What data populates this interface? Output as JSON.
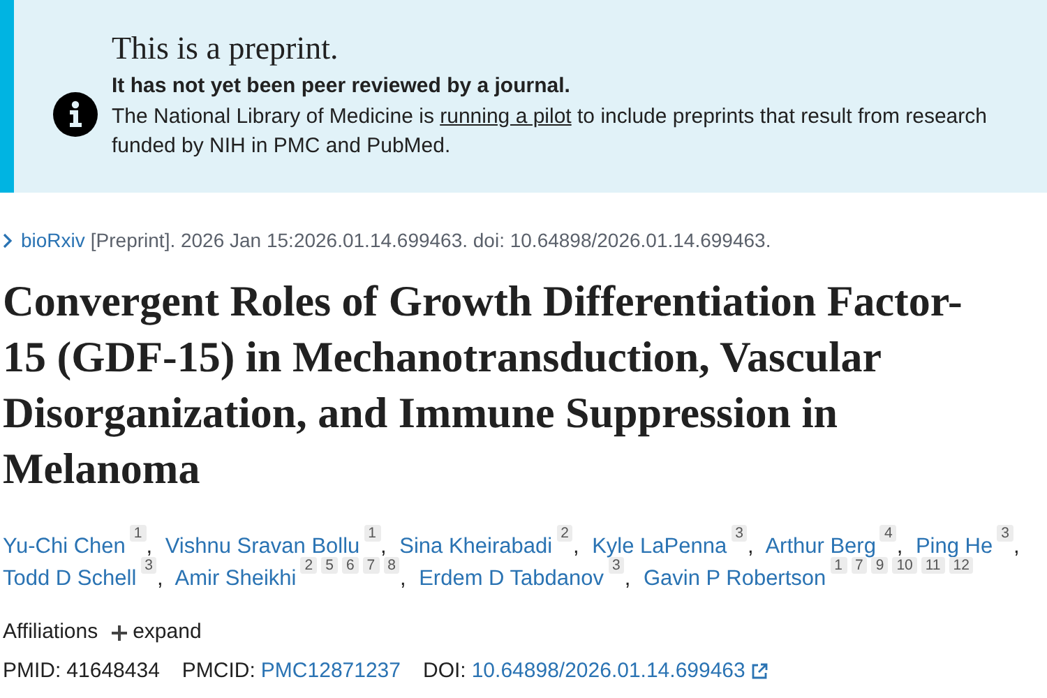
{
  "notice": {
    "title": "This is a preprint.",
    "subtitle": "It has not yet been peer reviewed by a journal.",
    "body_before": "The National Library of Medicine is",
    "link": "running a pilot",
    "body_after": "to include preprints that result from research funded by NIH in PMC and PubMed."
  },
  "citation": {
    "source": "bioRxiv",
    "details": "[Preprint]. 2026 Jan 15:2026.01.14.699463. doi: 10.64898/2026.01.14.699463."
  },
  "title": "Convergent Roles of Growth Differentiation Factor-15 (GDF-15) in Mechanotransduction, Vascular Disorganization, and Immune Suppression in Melanoma",
  "authors": [
    {
      "name": "Yu-Chi Chen",
      "affiliations": [
        "1"
      ],
      "separator": ","
    },
    {
      "name": "Vishnu Sravan Bollu",
      "affiliations": [
        "1"
      ],
      "separator": ","
    },
    {
      "name": "Sina Kheirabadi",
      "affiliations": [
        "2"
      ],
      "separator": ","
    },
    {
      "name": "Kyle LaPenna",
      "affiliations": [
        "3"
      ],
      "separator": ","
    },
    {
      "name": "Arthur Berg",
      "affiliations": [
        "4"
      ],
      "separator": ","
    },
    {
      "name": "Ping He",
      "affiliations": [
        "3"
      ],
      "separator": ","
    },
    {
      "name": "Todd D Schell",
      "affiliations": [
        "3"
      ],
      "separator": ","
    },
    {
      "name": "Amir Sheikhi",
      "affiliations": [
        "2",
        "5",
        "6",
        "7",
        "8"
      ],
      "separator": ","
    },
    {
      "name": "Erdem D Tabdanov",
      "affiliations": [
        "3"
      ],
      "separator": ","
    },
    {
      "name": "Gavin P Robertson",
      "affiliations": [
        "1",
        "7",
        "9",
        "10",
        "11",
        "12"
      ]
    }
  ],
  "affiliations": {
    "label": "Affiliations",
    "toggle": "expand",
    "expanded": false
  },
  "ids": [
    {
      "label": "PMID:",
      "value": "41648434",
      "kind": "text"
    },
    {
      "label": "PMCID:",
      "value": "PMC12871237",
      "kind": "link"
    },
    {
      "label": "DOI:",
      "value": "10.64898/2026.01.14.699463",
      "kind": "external"
    }
  ]
}
